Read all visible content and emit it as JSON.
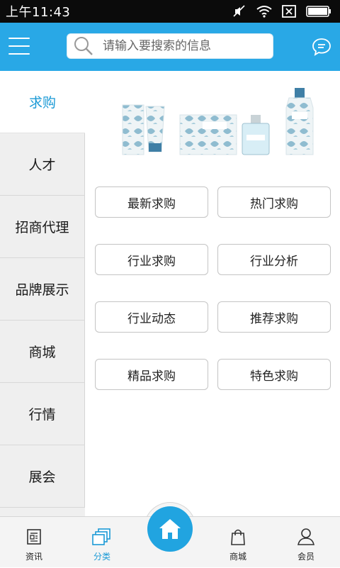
{
  "status_bar": {
    "time": "上午11:43"
  },
  "header": {
    "search_placeholder": "请输入要搜索的信息",
    "menu_icon": "hamburger-menu-icon",
    "chat_icon": "chat-bubble-icon"
  },
  "sidebar": {
    "items": [
      {
        "label": "求购",
        "active": true
      },
      {
        "label": "人才"
      },
      {
        "label": "招商代理"
      },
      {
        "label": "品牌展示"
      },
      {
        "label": "商城"
      },
      {
        "label": "行情"
      },
      {
        "label": "展会"
      }
    ]
  },
  "grid": {
    "buttons": [
      "最新求购",
      "热门求购",
      "行业求购",
      "行业分析",
      "行业动态",
      "推荐求购",
      "精品求购",
      "特色求购"
    ]
  },
  "tabbar": {
    "tabs": [
      {
        "label": "资讯"
      },
      {
        "label": "分类",
        "active": true
      },
      {
        "label": "商城"
      },
      {
        "label": "会员"
      }
    ]
  },
  "colors": {
    "accent": "#29a8e6",
    "active_text": "#1b9ad6"
  }
}
